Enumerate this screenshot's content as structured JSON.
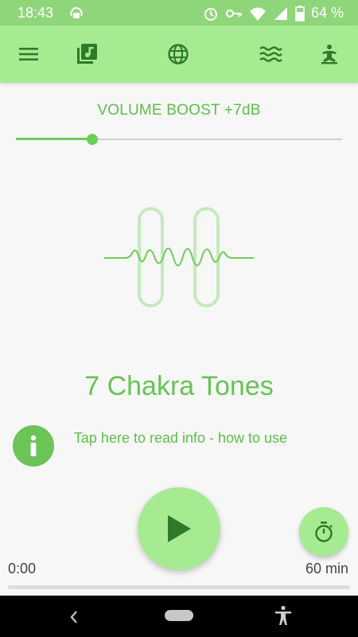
{
  "status_bar": {
    "time": "18:43",
    "battery_percent": "64 %",
    "icons": [
      "hotspot-icon",
      "alarm-icon",
      "vpn-key-icon",
      "wifi-icon",
      "signal-icon",
      "battery-icon"
    ]
  },
  "toolbar": {
    "icons": [
      "menu-icon",
      "library-music-icon",
      "globe-icon",
      "waves-icon",
      "meditation-icon"
    ]
  },
  "volume": {
    "label": "VOLUME BOOST +7dB",
    "level": 0.235
  },
  "track": {
    "title": "7 Chakra Tones",
    "info_text": "Tap here to read info - how to use"
  },
  "player": {
    "current_time": "0:00",
    "duration": "60 min",
    "progress": 0.0
  },
  "colors": {
    "accent": "#6ccd58",
    "appbar": "#a6ea92",
    "statusbar": "#8fd67a",
    "text_green": "#5cbf4a"
  }
}
